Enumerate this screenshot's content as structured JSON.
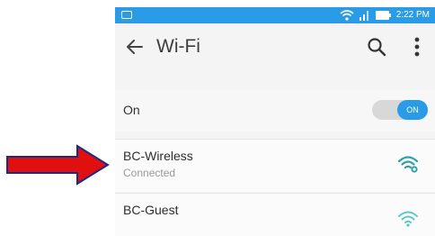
{
  "annotation": {
    "arrow_color": "#e01010",
    "arrow_outline": "#1a2a8a"
  },
  "status_bar": {
    "time": "2:22 PM",
    "notification_icon": "notification-icon",
    "wifi_icon": "wifi-status-icon",
    "signal_icon": "signal-icon",
    "battery_icon": "battery-icon",
    "bg_color": "#2a9be6"
  },
  "app_bar": {
    "title": "Wi-Fi",
    "back_icon": "back-arrow-icon",
    "search_icon": "search-icon",
    "more_icon": "more-vert-icon"
  },
  "wifi_toggle": {
    "label": "On",
    "switch_text": "ON",
    "state": "on",
    "accent": "#2a9be6"
  },
  "networks": [
    {
      "name": "BC-Wireless",
      "status": "Connected",
      "icon": "wifi-secured-icon"
    },
    {
      "name": "BC-Guest",
      "status": "",
      "icon": "wifi-icon"
    }
  ]
}
